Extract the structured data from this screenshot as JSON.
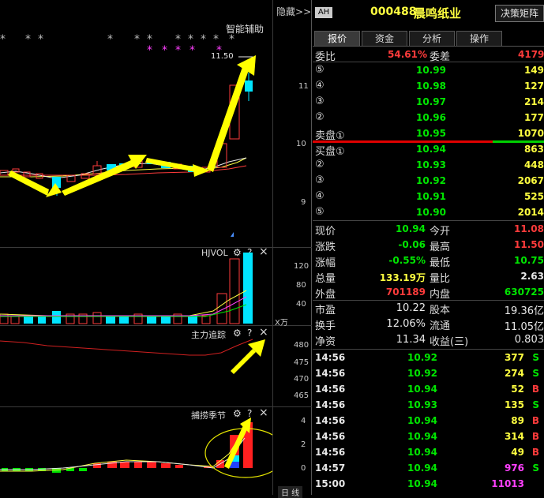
{
  "header": {
    "hide_label": "隐藏",
    "hide_arrows": ">>",
    "market_badge": "AH",
    "stock_code": "000488",
    "stock_name": "晨鸣纸业",
    "matrix_button": "决策矩阵"
  },
  "colors": {
    "up": "#ff3b3b",
    "down": "#00e600",
    "cyan": "#00e5ff",
    "yellow": "#ffff40"
  },
  "main_chart": {
    "title": "智能辅助",
    "price_marker": "11.50",
    "y_ticks": [
      "11",
      "10",
      "9"
    ],
    "star_symbol": "*"
  },
  "volume_panel": {
    "title": "HJVOL",
    "y_ticks": [
      "120",
      "80",
      "40"
    ],
    "unit": "X万"
  },
  "trend_panel": {
    "title": "主力追踪",
    "y_ticks": [
      "480",
      "475",
      "470",
      "465"
    ]
  },
  "season_panel": {
    "title": "捕捞季节",
    "y_ticks": [
      "4",
      "2",
      "0"
    ],
    "period_tab": "日 线"
  },
  "panel_controls": {
    "gear": "⚙",
    "help": "?",
    "close": "×"
  },
  "tabs": [
    {
      "label": "报价",
      "active": true
    },
    {
      "label": "资金",
      "active": false
    },
    {
      "label": "分析",
      "active": false
    },
    {
      "label": "操作",
      "active": false
    }
  ],
  "ratio": {
    "label1": "委比",
    "value1": "54.61%",
    "label2": "委差",
    "value2": "4179"
  },
  "sell_orders": [
    {
      "label": "⑤",
      "price": "10.99",
      "vol": "149"
    },
    {
      "label": "④",
      "price": "10.98",
      "vol": "127"
    },
    {
      "label": "③",
      "price": "10.97",
      "vol": "214"
    },
    {
      "label": "②",
      "price": "10.96",
      "vol": "177"
    },
    {
      "label": "卖盘①",
      "price": "10.95",
      "vol": "1070"
    }
  ],
  "buy_orders": [
    {
      "label": "买盘①",
      "price": "10.94",
      "vol": "863"
    },
    {
      "label": "②",
      "price": "10.93",
      "vol": "448"
    },
    {
      "label": "③",
      "price": "10.92",
      "vol": "2067"
    },
    {
      "label": "④",
      "price": "10.91",
      "vol": "525"
    },
    {
      "label": "⑤",
      "price": "10.90",
      "vol": "2014"
    }
  ],
  "stats": [
    {
      "l1": "现价",
      "v1": "10.94",
      "c1": "green",
      "l2": "今开",
      "v2": "11.08",
      "c2": "red"
    },
    {
      "l1": "涨跌",
      "v1": "-0.06",
      "c1": "green",
      "l2": "最高",
      "v2": "11.50",
      "c2": "red"
    },
    {
      "l1": "涨幅",
      "v1": "-0.55%",
      "c1": "green",
      "l2": "最低",
      "v2": "10.75",
      "c2": "green"
    },
    {
      "l1": "总量",
      "v1": "133.19万",
      "c1": "yellow",
      "l2": "量比",
      "v2": "2.63",
      "c2": "white"
    },
    {
      "l1": "外盘",
      "v1": "701189",
      "c1": "red",
      "l2": "内盘",
      "v2": "630725",
      "c2": "green"
    }
  ],
  "fundamentals": [
    {
      "l1": "市盈",
      "v1": "10.22",
      "l2": "股本",
      "v2": "19.36亿"
    },
    {
      "l1": "换手",
      "v1": "12.06%",
      "l2": "流通",
      "v2": "11.05亿"
    },
    {
      "l1": "净资",
      "v1": "11.34",
      "l2": "收益(三)",
      "v2": "0.803"
    }
  ],
  "trades": [
    {
      "time": "14:56",
      "price": "10.92",
      "vol": "377",
      "side": "S"
    },
    {
      "time": "14:56",
      "price": "10.92",
      "vol": "274",
      "side": "S"
    },
    {
      "time": "14:56",
      "price": "10.94",
      "vol": "52",
      "side": "B"
    },
    {
      "time": "14:56",
      "price": "10.93",
      "vol": "135",
      "side": "S"
    },
    {
      "time": "14:56",
      "price": "10.94",
      "vol": "89",
      "side": "B"
    },
    {
      "time": "14:56",
      "price": "10.94",
      "vol": "314",
      "side": "B"
    },
    {
      "time": "14:56",
      "price": "10.94",
      "vol": "49",
      "side": "B"
    },
    {
      "time": "14:57",
      "price": "10.94",
      "vol": "976",
      "side": "S"
    },
    {
      "time": "15:00",
      "price": "10.94",
      "vol": "11013",
      "side": ""
    }
  ]
}
